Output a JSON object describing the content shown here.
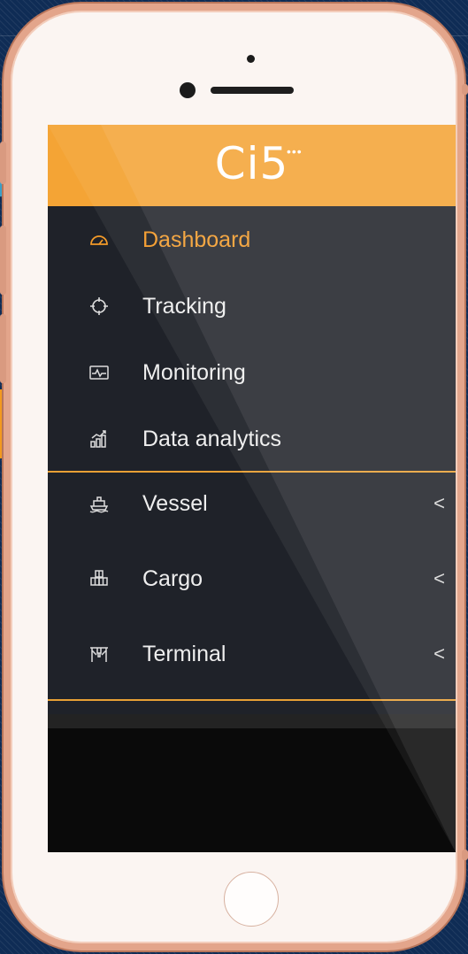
{
  "colors": {
    "accent": "#f39a29",
    "header_bg": "#f4a435",
    "menu_bg": "#1f2229",
    "frame": "#e3a58b"
  },
  "app": {
    "logo": "Ci5",
    "logo_dots": "•••"
  },
  "menu": {
    "items": [
      {
        "label": "Dashboard",
        "icon": "speedometer-icon",
        "active": true,
        "chevron": ""
      },
      {
        "label": "Tracking",
        "icon": "crosshair-icon",
        "active": false,
        "chevron": ""
      },
      {
        "label": "Monitoring",
        "icon": "monitor-pulse-icon",
        "active": false,
        "chevron": ""
      },
      {
        "label": "Data analytics",
        "icon": "bar-chart-icon",
        "active": false,
        "chevron": ""
      },
      {
        "label": "Vessel",
        "icon": "ship-icon",
        "active": false,
        "chevron": "<"
      },
      {
        "label": "Cargo",
        "icon": "boxes-icon",
        "active": false,
        "chevron": "<"
      },
      {
        "label": "Terminal",
        "icon": "crane-icon",
        "active": false,
        "chevron": "<"
      }
    ]
  }
}
